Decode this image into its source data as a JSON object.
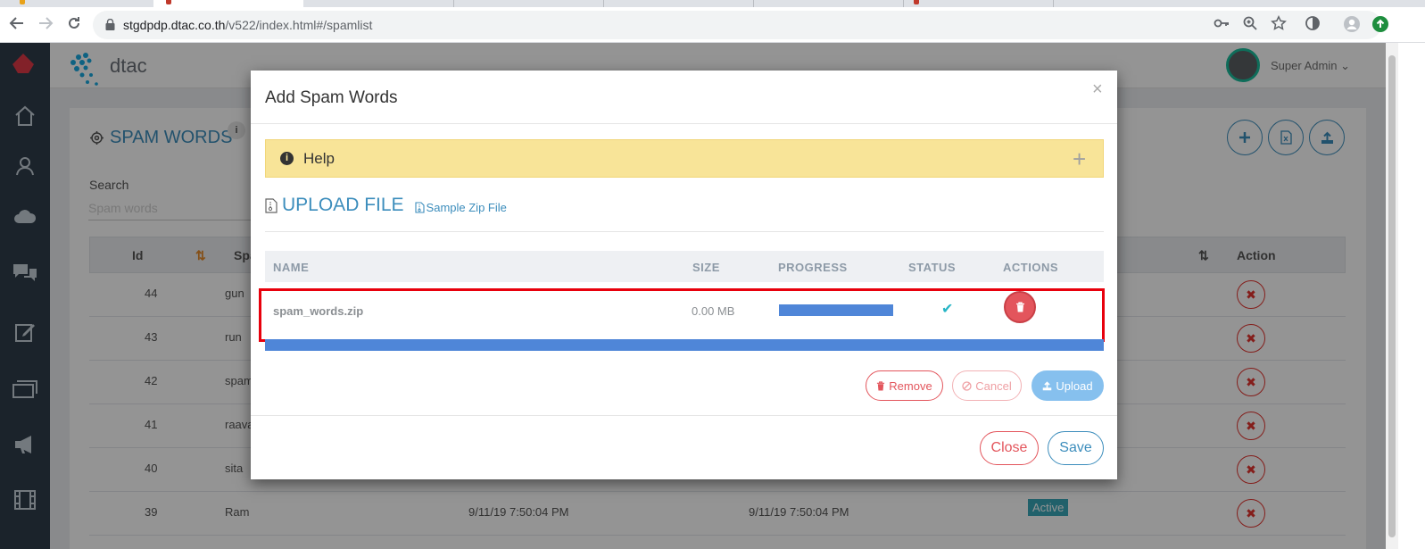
{
  "browser": {
    "url_host": "stgdpdp.dtac.co.th",
    "url_path": "/v522/index.html#/spamlist"
  },
  "app": {
    "brand": "dtac",
    "user_name": "Super Admin",
    "sidebar_icons": [
      "home-icon",
      "users-icon",
      "cloud-icon",
      "chat-icon",
      "edit-icon",
      "tickets-icon",
      "megaphone-icon",
      "film-icon"
    ]
  },
  "page": {
    "title": "SPAM WORDS",
    "info_badge": "i",
    "search_label": "Search",
    "search_placeholder": "Spam words",
    "table": {
      "col_id": "Id",
      "col_spam": "Spa",
      "col_action": "Action",
      "rows": [
        {
          "id": "44",
          "word": "gun"
        },
        {
          "id": "43",
          "word": "run"
        },
        {
          "id": "42",
          "word": "spam"
        },
        {
          "id": "41",
          "word": "raava"
        },
        {
          "id": "40",
          "word": "sita"
        },
        {
          "id": "39",
          "word": "Ram",
          "created": "9/11/19 7:50:04 PM",
          "updated": "9/11/19 7:50:04 PM",
          "status": "Active"
        }
      ]
    }
  },
  "modal": {
    "title": "Add Spam Words",
    "close_glyph": "×",
    "help_label": "Help",
    "help_toggle": "+",
    "upload_title": "UPLOAD FILE",
    "sample_link": "Sample Zip File",
    "file_table": {
      "col_name": "NAME",
      "col_size": "SIZE",
      "col_progress": "PROGRESS",
      "col_status": "STATUS",
      "col_actions": "ACTIONS"
    },
    "file": {
      "name": "spam_words.zip",
      "size": "0.00 MB",
      "progress_percent": 100,
      "status": "✔"
    },
    "buttons": {
      "remove": "Remove",
      "cancel": "Cancel",
      "upload": "Upload",
      "close": "Close",
      "save": "Save"
    }
  }
}
